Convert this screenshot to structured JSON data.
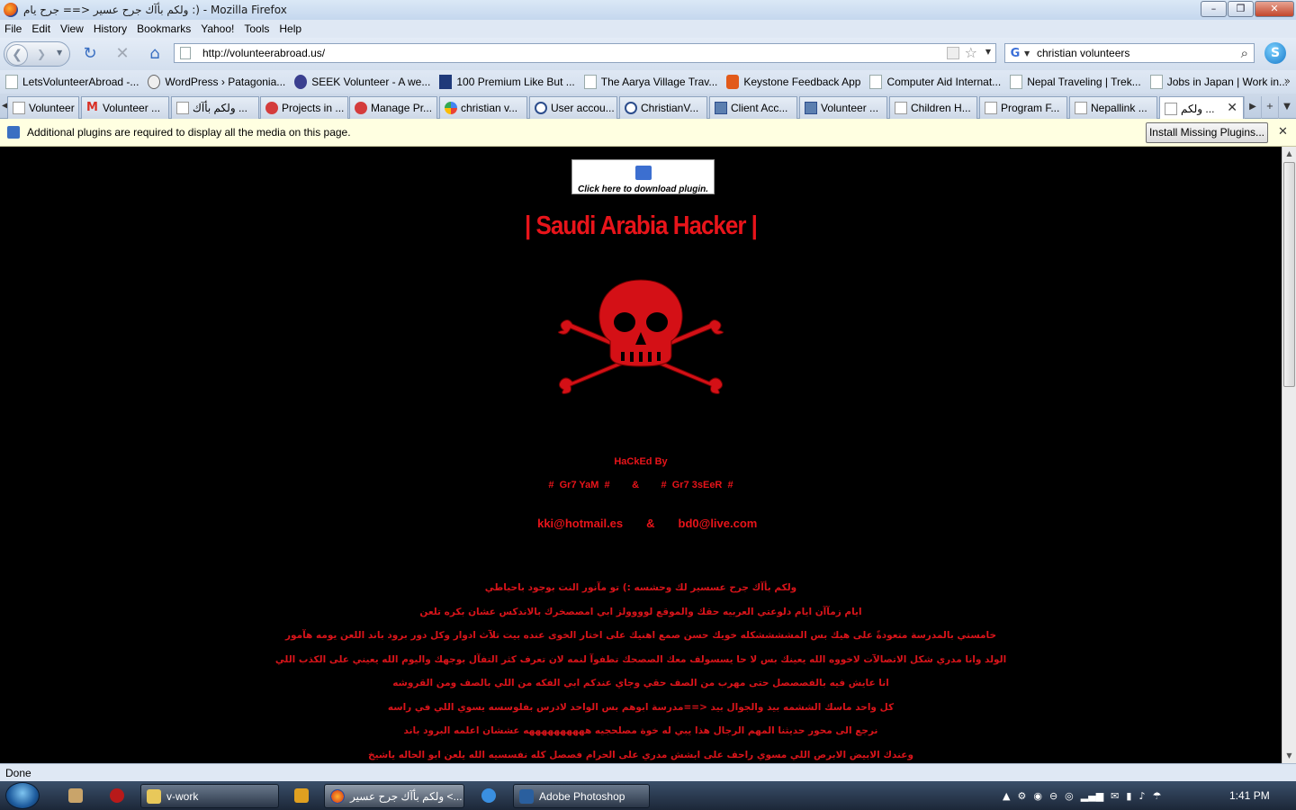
{
  "window": {
    "title": "ولكم بأآك جرح عسير <== جرح يام :) - Mozilla Firefox",
    "minimize": "–",
    "maximize": "❐",
    "close": "✕"
  },
  "menu": [
    "File",
    "Edit",
    "View",
    "History",
    "Bookmarks",
    "Yahoo!",
    "Tools",
    "Help"
  ],
  "nav": {
    "url": "http://volunteerabroad.us/",
    "search_query": "christian volunteers"
  },
  "bookmarks": [
    {
      "label": "LetsVolunteerAbroad -...",
      "icon": "page-icon"
    },
    {
      "label": "WordPress › Patagonia...",
      "icon": "wordpress-icon"
    },
    {
      "label": "SEEK Volunteer - A we...",
      "icon": "seek-icon"
    },
    {
      "label": "100 Premium Like But ...",
      "icon": "premium-icon"
    },
    {
      "label": "The Aarya Village Trav...",
      "icon": "page-icon"
    },
    {
      "label": "Keystone Feedback App",
      "icon": "keystone-icon"
    },
    {
      "label": "Computer Aid Internat...",
      "icon": "page-icon"
    },
    {
      "label": "Nepal Traveling | Trek...",
      "icon": "page-icon"
    },
    {
      "label": "Jobs in Japan | Work in...",
      "icon": "page-icon"
    }
  ],
  "tabs": [
    {
      "label": "Volunteer ...",
      "icon": "page-icon"
    },
    {
      "label": "Volunteer ...",
      "icon": "gmail-icon"
    },
    {
      "label": "ولكم بأآك ...",
      "icon": "page-icon"
    },
    {
      "label": "Projects in ...",
      "icon": "flower-icon"
    },
    {
      "label": "Manage Pr...",
      "icon": "flower-icon"
    },
    {
      "label": "christian v...",
      "icon": "google-icon"
    },
    {
      "label": "User accou...",
      "icon": "power-icon"
    },
    {
      "label": "ChristianV...",
      "icon": "power-icon"
    },
    {
      "label": "Client Acc...",
      "icon": "monitor-icon"
    },
    {
      "label": "Volunteer ...",
      "icon": "monitor-icon"
    },
    {
      "label": "Children H...",
      "icon": "page-icon"
    },
    {
      "label": "Program F...",
      "icon": "page-icon"
    },
    {
      "label": "Nepallink ...",
      "icon": "page-icon"
    },
    {
      "label": "ولكم ...",
      "icon": "page-icon"
    }
  ],
  "notification": {
    "text": "Additional plugins are required to display all the media on this page.",
    "button": "Install Missing Plugins..."
  },
  "page": {
    "plugin_label": "Click here to download plugin.",
    "title": "| Saudi Arabia Hacker |",
    "hacked_by": "HaCkEd By",
    "names": "#  Gr7 YaM  #        &        #  Gr7 3sEeR  #",
    "email1": "kki@hotmail.es",
    "amp": "&",
    "email2": "bd0@live.com",
    "arabic_lines": [
      "ولكم بأآك جرح عسسير لك وحشسه :) تو مآنور النت بوجود باحياطي",
      "ايام زمآآن ايام دلوعتي العربيه حقك والموقع لوووولز ابي امصصخرك بالاندكس عشان بكره تلعن",
      "خامستي بالمدرسة متعودةً على هيك بس المششششكله خويك حسن صمع اهنيك على اختار الخوى عنده بيت تلآث ادوار وكل دور برود باند اللعن يومه هآمور",
      "الولد وانا مدري شكل الاتصالآت لاخووه الله يعينك بس لا حا يسسولف معك الصصحك تطفوآ لنمه لان تعرف كثر التفآل بوجهك واليوم الله يعيني على الكذب اللي",
      "انا عايش فيه بالفصصصل حتى مهرب من الصف حقي وجاي عندكم ابي الفكه من اللي بالصف ومن القروشه",
      "كل واحد ماسك الششمه بيد والجوال بيد <==مدرسة ابوهم بس الواحد لادرس بفلوسسه يسوي اللي في راسه",
      "نرجع الى محور حديثنا المهم الرجال هذا يبي له خوة مصلحجيه ههههههههههه عششان اعلمه البرود باند",
      "وعندك الابيض الابرص اللي مسوي راحف على ابشش مدري على الحرام فصصل كله نفسسيه الله يلعن ابو الحاله ياشيخ"
    ]
  },
  "status": "Done",
  "taskbar": {
    "tasks": [
      "v-work",
      "ولكم بأآك جرح عسير <...",
      "Adobe Photoshop"
    ],
    "clock": "1:41 PM"
  },
  "colors": {
    "hacker_red": "#e8141a",
    "page_bg": "#000000"
  }
}
